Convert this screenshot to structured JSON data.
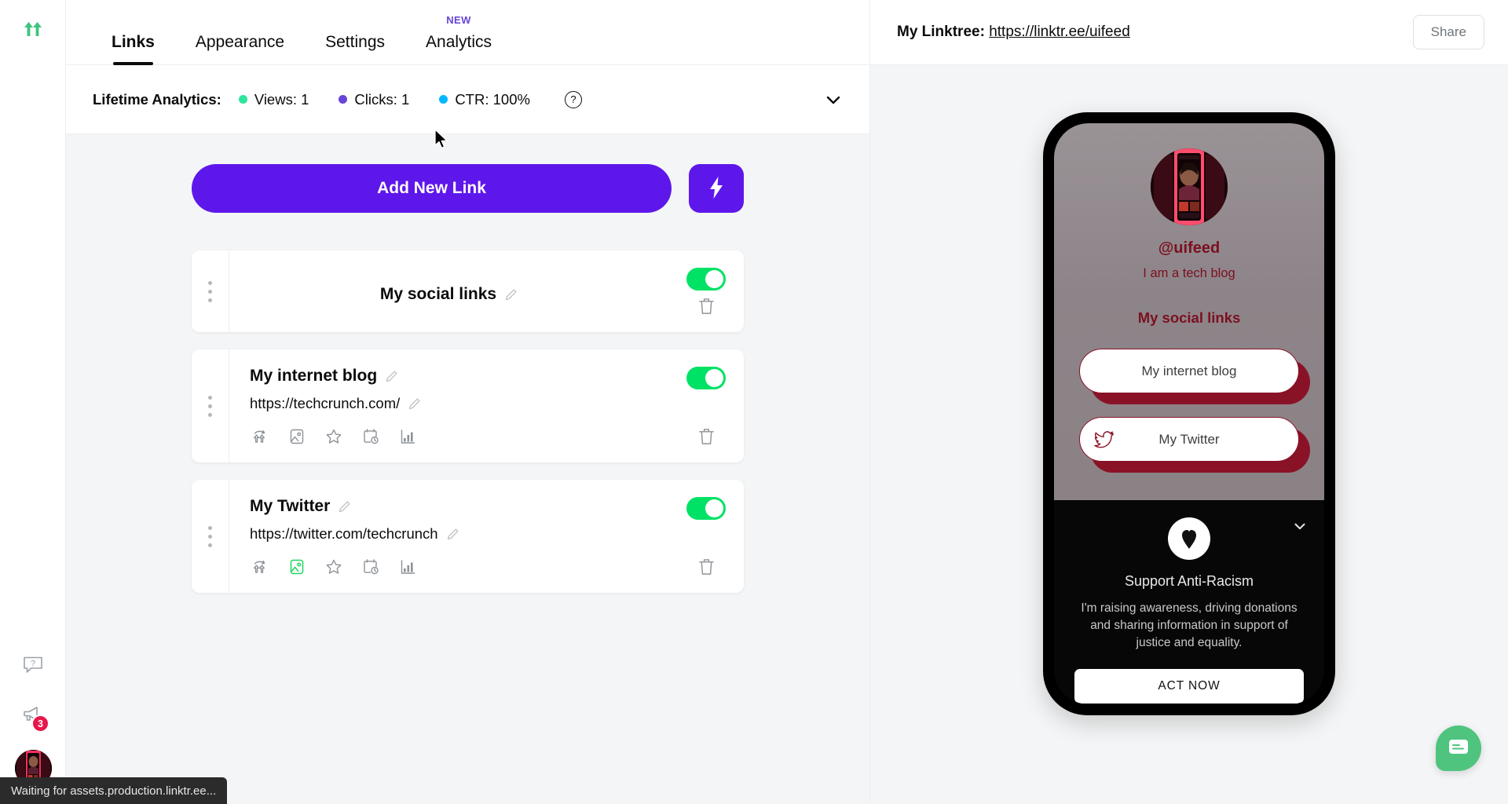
{
  "brand": {
    "logo_icon": "linktree-logo-icon",
    "logo_color": "#3dc47e"
  },
  "topnav": {
    "tabs": [
      {
        "label": "Links",
        "active": true
      },
      {
        "label": "Appearance",
        "active": false
      },
      {
        "label": "Settings",
        "active": false
      },
      {
        "label": "Analytics",
        "active": false,
        "badge": "NEW"
      }
    ]
  },
  "stats": {
    "label": "Lifetime Analytics:",
    "items": [
      {
        "label": "Views: 1",
        "color": "#2ee59d"
      },
      {
        "label": "Clicks: 1",
        "color": "#6645d6"
      },
      {
        "label": "CTR: 100%",
        "color": "#00b7ff"
      }
    ],
    "help_icon": "question-mark-icon",
    "help_glyph": "?",
    "collapse_icon": "chevron-down-icon"
  },
  "actions": {
    "add_new_link": "Add New Link",
    "bolt_icon": "lightning-bolt-icon"
  },
  "link_cards": [
    {
      "kind": "header",
      "title": "My social links",
      "url": null,
      "enabled": true,
      "toggle_color": "#00e265",
      "icons": []
    },
    {
      "kind": "link",
      "title": "My internet blog",
      "url": "https://techcrunch.com/",
      "enabled": true,
      "toggle_color": "#00e265",
      "icons": [
        {
          "name": "linktree-animate-icon",
          "active": false
        },
        {
          "name": "thumbnail-image-icon",
          "active": false
        },
        {
          "name": "star-prioritize-icon",
          "active": false
        },
        {
          "name": "schedule-clock-icon",
          "active": false
        },
        {
          "name": "link-analytics-icon",
          "active": false
        }
      ]
    },
    {
      "kind": "link",
      "title": "My Twitter",
      "url": "https://twitter.com/techcrunch",
      "enabled": true,
      "toggle_color": "#00e265",
      "icons": [
        {
          "name": "linktree-animate-icon",
          "active": false
        },
        {
          "name": "thumbnail-image-icon",
          "active": true
        },
        {
          "name": "star-prioritize-icon",
          "active": false
        },
        {
          "name": "schedule-clock-icon",
          "active": false
        },
        {
          "name": "link-analytics-icon",
          "active": false
        }
      ]
    }
  ],
  "card_controls": {
    "edit_icon": "pencil-edit-icon",
    "delete_icon": "trash-delete-icon",
    "drag_icon": "drag-handle-icon"
  },
  "preview_header": {
    "prefix": "My Linktree:",
    "url": "https://linktr.ee/uifeed",
    "share_label": "Share"
  },
  "phone_preview": {
    "handle": "@uifeed",
    "bio": "I am a tech blog",
    "heading": "My social links",
    "theme": {
      "background_top": "#9a9396",
      "background_bottom": "#8b8285",
      "text_color": "#7b1020",
      "button_face": "#ffffff",
      "button_shadow": "#8a1227"
    },
    "buttons": [
      {
        "label": "My internet blog",
        "icon": null
      },
      {
        "label": "My Twitter",
        "icon": "twitter-bird-icon"
      }
    ],
    "banner": {
      "icon": "anti-racism-heart-icon",
      "title": "Support Anti-Racism",
      "body": "I'm raising awareness, driving donations and sharing information in support of justice and equality.",
      "cta": "ACT NOW",
      "collapse_icon": "chevron-down-icon"
    }
  },
  "rail": {
    "help_icon": "help-chat-icon",
    "announcements_icon": "megaphone-icon",
    "announcements_badge": "3",
    "avatar_icon": "user-avatar"
  },
  "chat_widget": {
    "icon": "chat-message-icon",
    "color": "#4ec47f"
  },
  "statusbar": {
    "text": "Waiting for assets.production.linktr.ee..."
  }
}
